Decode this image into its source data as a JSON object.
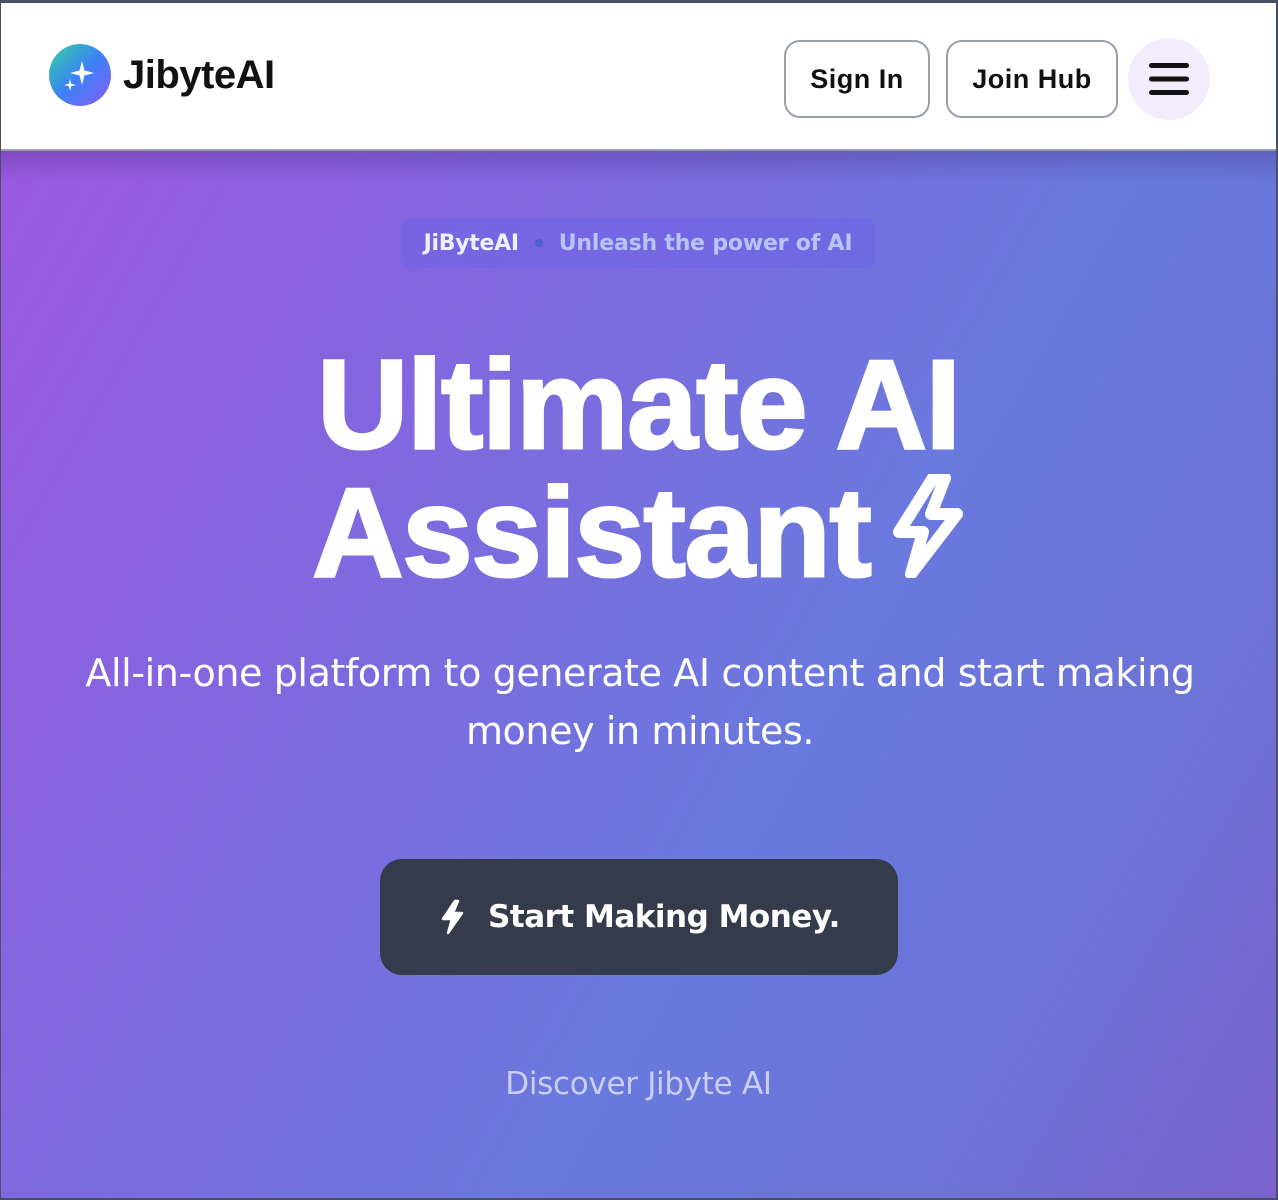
{
  "header": {
    "brand": "JibyteAI",
    "logo_icon": "sparkles-icon",
    "sign_in_label": "Sign In",
    "join_label": "Join Hub",
    "menu_icon": "hamburger-menu-icon"
  },
  "hero": {
    "badge_brand": "JiByteAI",
    "badge_tagline": "Unleash the power of AI",
    "title_line1": "Ultimate AI",
    "title_line2": "Assistant",
    "title_icon": "lightning-bolt-icon",
    "subtitle": "All-in-one platform to generate AI content and start making money in minutes.",
    "cta_label": "Start Making Money.",
    "cta_icon": "lightning-bolt-icon",
    "discover_label": "Discover Jibyte AI"
  },
  "colors": {
    "header_bg": "#ffffff",
    "hero_gradient_start": "#9a58e0",
    "hero_gradient_end": "#6a79de",
    "cta_bg": "#343b4a",
    "menu_bg": "#f3ecfd"
  }
}
